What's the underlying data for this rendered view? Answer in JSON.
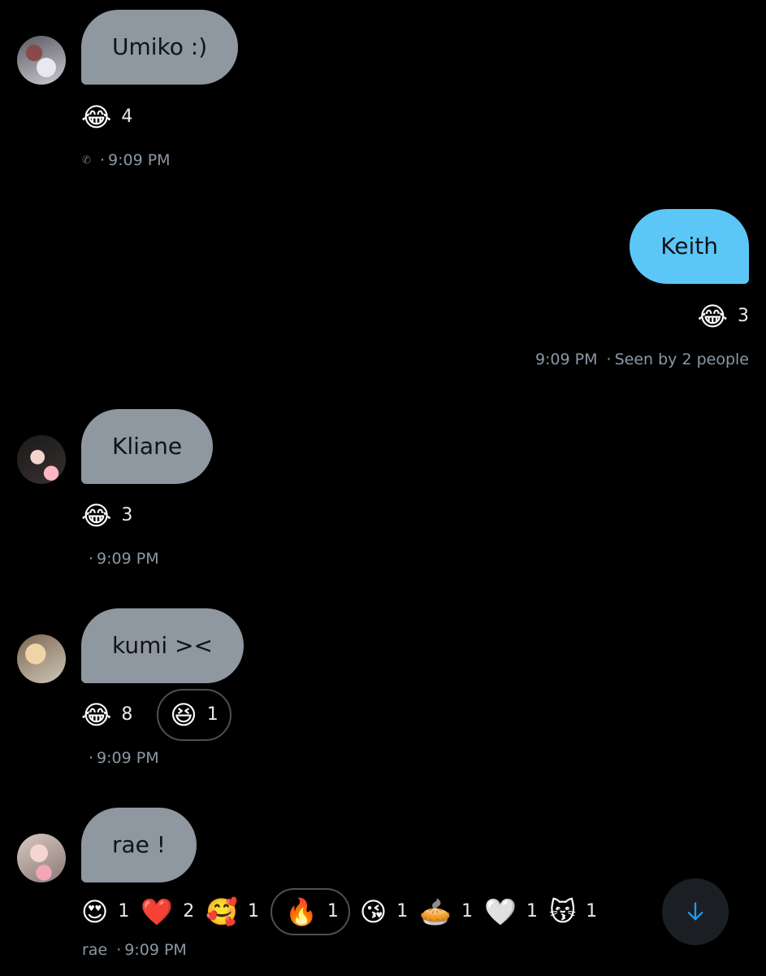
{
  "messages": [
    {
      "sender": "other",
      "text": "Umiko :)",
      "reactions": [
        {
          "emoji": "😂",
          "count": "4",
          "mine": false
        }
      ],
      "sender_label": "",
      "time": "9:09 PM",
      "phone_icon": "phone-icon"
    },
    {
      "sender": "me",
      "text": "Keith",
      "reactions": [
        {
          "emoji": "😂",
          "count": "3",
          "mine": false
        }
      ],
      "time": "9:09 PM",
      "seen": "Seen by 2 people"
    },
    {
      "sender": "other",
      "text": "Kliane",
      "reactions": [
        {
          "emoji": "😂",
          "count": "3",
          "mine": false
        }
      ],
      "sender_label": "",
      "time": "9:09 PM"
    },
    {
      "sender": "other",
      "text": "kumi ><",
      "reactions": [
        {
          "emoji": "😂",
          "count": "8",
          "mine": false
        },
        {
          "emoji": "😆",
          "count": "1",
          "mine": true
        }
      ],
      "sender_label": "",
      "time": "9:09 PM"
    },
    {
      "sender": "other",
      "text": "rae !",
      "reactions": [
        {
          "emoji": "😍",
          "count": "1",
          "mine": false
        },
        {
          "emoji": "❤️",
          "count": "2",
          "mine": false
        },
        {
          "emoji": "🥰",
          "count": "1",
          "mine": false
        },
        {
          "emoji": "🔥",
          "count": "1",
          "mine": true
        },
        {
          "emoji": "😘",
          "count": "1",
          "mine": false
        },
        {
          "emoji": "🥧",
          "count": "1",
          "mine": false
        },
        {
          "emoji": "🤍",
          "count": "1",
          "mine": false
        },
        {
          "emoji": "😽",
          "count": "1",
          "mine": false
        }
      ],
      "sender_label": "rae",
      "time": "9:09 PM"
    }
  ],
  "separator": "·",
  "scroll_button": {
    "icon": "arrow-down-icon",
    "color": "#1d9bf0"
  },
  "colors": {
    "incoming_bubble": "#8f97a0",
    "outgoing_bubble": "#5cc7f7",
    "background": "#000000",
    "meta_text": "#8b98a5"
  }
}
